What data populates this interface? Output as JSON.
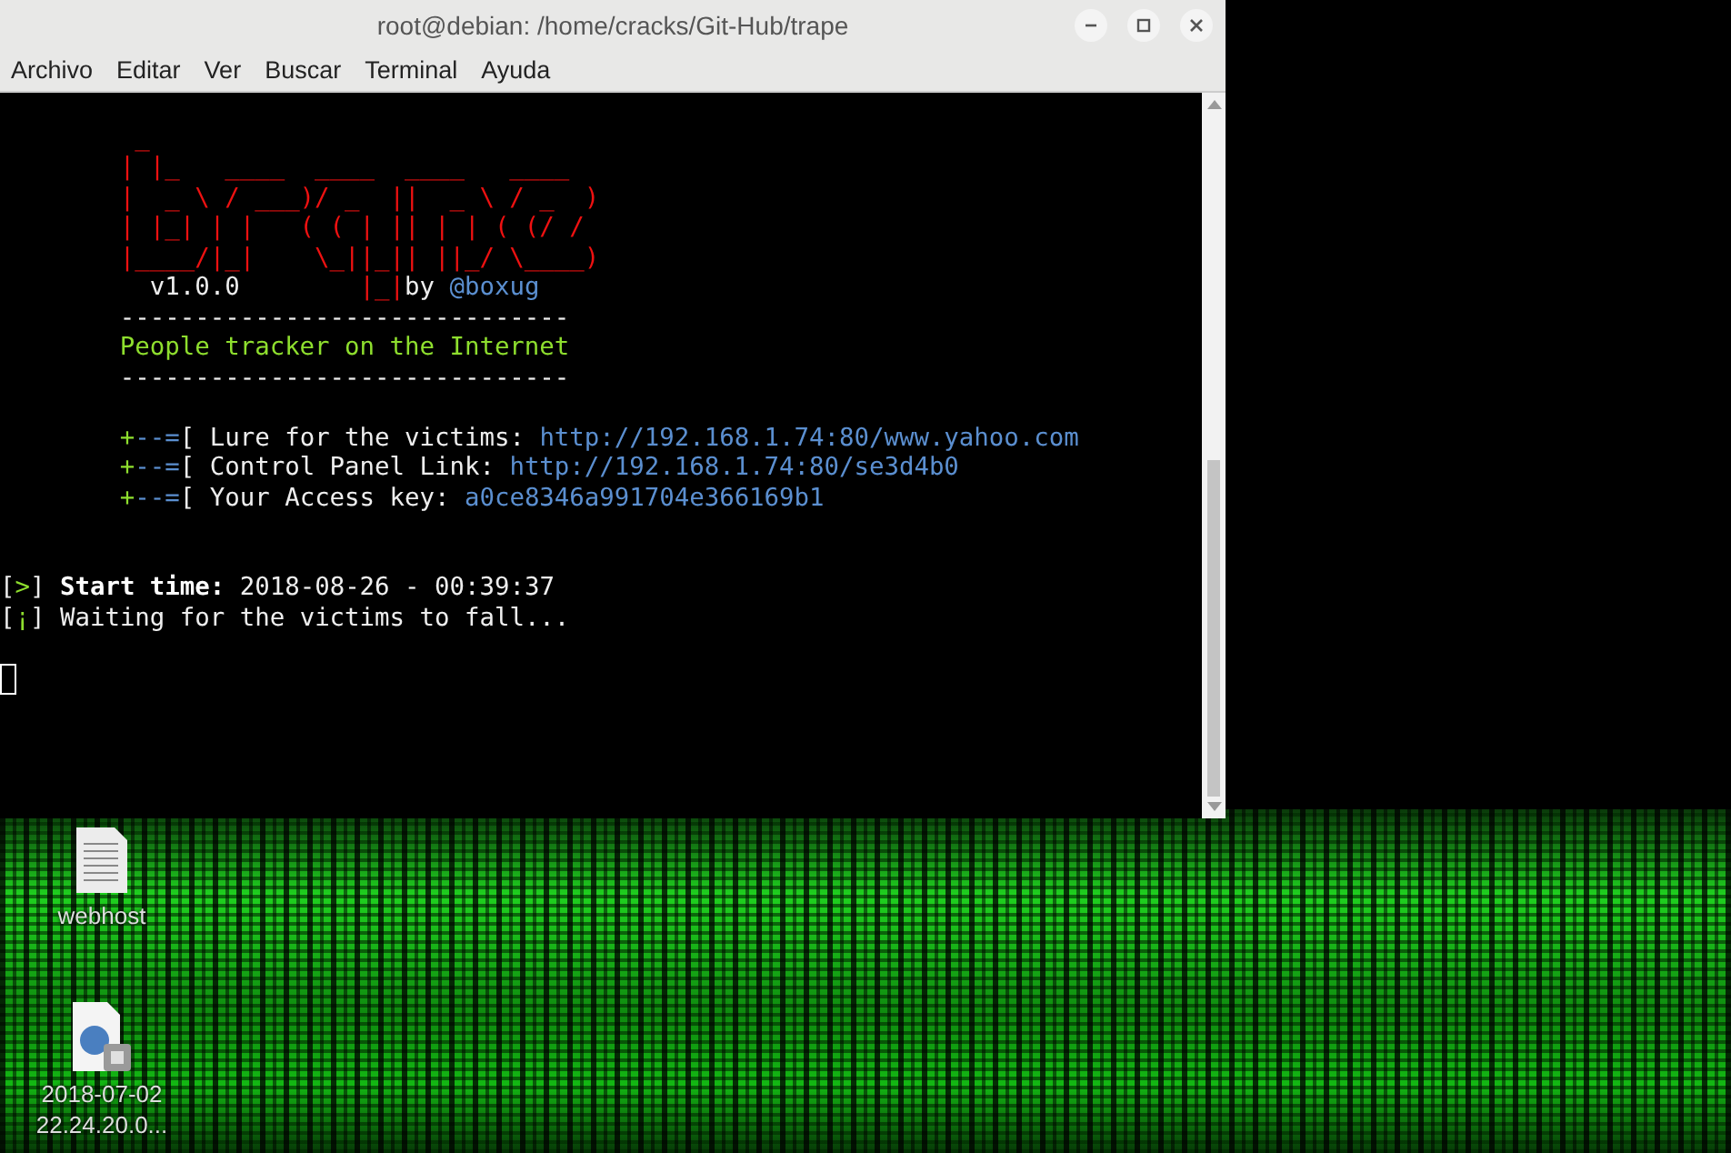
{
  "desktop": {
    "icons": [
      {
        "kind": "document",
        "label": "webhost"
      },
      {
        "kind": "web-file",
        "label": "2018-07-02 22.24.20.0..."
      }
    ]
  },
  "window": {
    "title": "root@debian: /home/cracks/Git-Hub/trape",
    "menu": [
      "Archivo",
      "Editar",
      "Ver",
      "Buscar",
      "Terminal",
      "Ayuda"
    ],
    "terminal": {
      "lines": [
        {
          "kind": "blank"
        },
        {
          "kind": "text",
          "spans": [
            {
              "kind": "art",
              "text": "         _"
            }
          ]
        },
        {
          "kind": "text",
          "spans": [
            {
              "kind": "art",
              "text": "        | |_   ____  ____  ____   ____"
            }
          ]
        },
        {
          "kind": "text",
          "spans": [
            {
              "kind": "art",
              "text": "        |  _ \\ / ___)/ _  ||  _ \\ / _  )"
            }
          ]
        },
        {
          "kind": "text",
          "spans": [
            {
              "kind": "art",
              "text": "        | |_| | |   ( ( | || | | ( (/ /"
            }
          ]
        },
        {
          "kind": "text",
          "spans": [
            {
              "kind": "art",
              "text": "        |____/|_|    \\_||_|| ||_/ \\____)"
            }
          ]
        },
        {
          "kind": "text",
          "spans": [
            {
              "kind": "plain",
              "text": "          v1.0.0        "
            },
            {
              "kind": "art",
              "text": "|_|"
            },
            {
              "kind": "plain",
              "text": "by "
            },
            {
              "kind": "link",
              "text": "@boxug"
            }
          ]
        },
        {
          "kind": "text",
          "spans": [
            {
              "kind": "plain",
              "text": "        ------------------------------"
            }
          ]
        },
        {
          "kind": "text",
          "spans": [
            {
              "kind": "accent",
              "text": "        People tracker on the Internet"
            }
          ]
        },
        {
          "kind": "text",
          "spans": [
            {
              "kind": "plain",
              "text": "        ------------------------------"
            }
          ]
        },
        {
          "kind": "blank"
        },
        {
          "kind": "text",
          "spans": [
            {
              "kind": "accent",
              "text": "        +"
            },
            {
              "kind": "link",
              "text": "--="
            },
            {
              "kind": "plain",
              "text": "[ Lure for the victims: "
            },
            {
              "kind": "link",
              "text": "http://192.168.1.74:80/www.yahoo.com"
            }
          ]
        },
        {
          "kind": "text",
          "spans": [
            {
              "kind": "accent",
              "text": "        +"
            },
            {
              "kind": "link",
              "text": "--="
            },
            {
              "kind": "plain",
              "text": "[ Control Panel Link: "
            },
            {
              "kind": "link",
              "text": "http://192.168.1.74:80/se3d4b0"
            }
          ]
        },
        {
          "kind": "text",
          "spans": [
            {
              "kind": "accent",
              "text": "        +"
            },
            {
              "kind": "link",
              "text": "--="
            },
            {
              "kind": "plain",
              "text": "[ Your Access key: "
            },
            {
              "kind": "link",
              "text": "a0ce8346a991704e366169b1"
            }
          ]
        },
        {
          "kind": "blank"
        },
        {
          "kind": "blank"
        },
        {
          "kind": "text",
          "spans": [
            {
              "kind": "plain",
              "text": "["
            },
            {
              "kind": "accent",
              "text": ">"
            },
            {
              "kind": "plain",
              "text": "] "
            },
            {
              "kind": "bold",
              "text": "Start time:"
            },
            {
              "kind": "plain",
              "text": " 2018-08-26 - 00:39:37"
            }
          ]
        },
        {
          "kind": "text",
          "spans": [
            {
              "kind": "plain",
              "text": "["
            },
            {
              "kind": "accent",
              "text": "¡"
            },
            {
              "kind": "plain",
              "text": "] Waiting for the victims to fall..."
            }
          ]
        },
        {
          "kind": "blank"
        },
        {
          "kind": "cursor"
        }
      ]
    }
  }
}
